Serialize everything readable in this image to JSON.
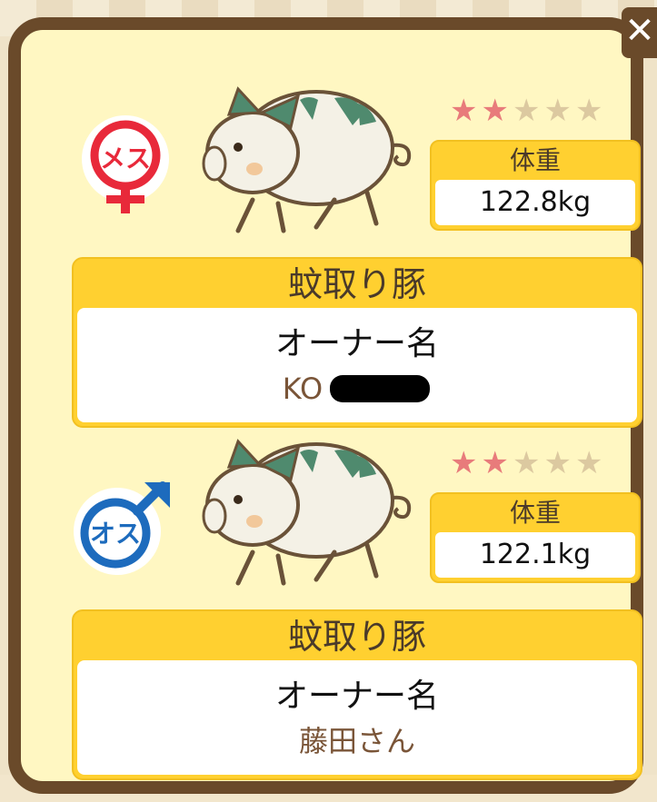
{
  "close_label": "✕",
  "pigs": [
    {
      "gender_icon": "female-symbol-icon",
      "gender_label": "メス",
      "gender_color": "#e8293a",
      "stars_total": 5,
      "stars_filled": 2,
      "weight_title": "体重",
      "weight_value": "122.8kg",
      "breed": "蚊取り豚",
      "owner_label": "オーナー名",
      "owner_name": "KO"
    },
    {
      "gender_icon": "male-symbol-icon",
      "gender_label": "オス",
      "gender_color": "#1d6bbd",
      "stars_total": 5,
      "stars_filled": 2,
      "weight_title": "体重",
      "weight_value": "122.1kg",
      "breed": "蚊取り豚",
      "owner_label": "オーナー名",
      "owner_name": "藤田さん"
    }
  ],
  "colors": {
    "frame": "#6a4a2a",
    "panel": "#fff7c2",
    "header_yellow": "#ffd030",
    "star_filled": "#e87b7b",
    "star_empty": "#dcc9a0"
  }
}
